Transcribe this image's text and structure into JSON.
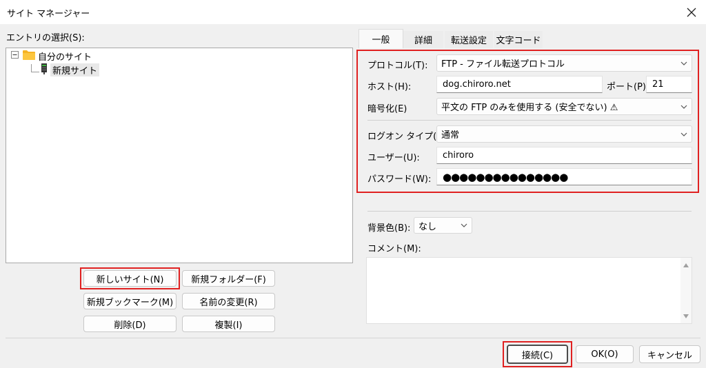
{
  "window": {
    "title": "サイト マネージャー"
  },
  "left": {
    "entries_label": "エントリの選択(S):",
    "tree": {
      "root_label": "自分のサイト",
      "child_label": "新規サイト"
    },
    "buttons": {
      "new_site": "新しいサイト(N)",
      "new_folder": "新規フォルダー(F)",
      "new_bookmark": "新規ブックマーク(M)",
      "rename": "名前の変更(R)",
      "delete": "削除(D)",
      "duplicate": "複製(I)"
    }
  },
  "tabs": [
    "一般",
    "詳細",
    "転送設定",
    "文字コード"
  ],
  "general": {
    "protocol_label": "プロトコル(T):",
    "protocol_value": "FTP - ファイル転送プロトコル",
    "host_label": "ホスト(H):",
    "host_value": "dog.chiroro.net",
    "port_label": "ポート(P):",
    "port_value": "21",
    "encryption_label": "暗号化(E)",
    "encryption_value": "平文の FTP のみを使用する (安全でない) ⚠",
    "logon_type_label": "ログオン タイプ(L):",
    "logon_type_value": "通常",
    "user_label": "ユーザー(U):",
    "user_value": "chiroro",
    "password_label": "パスワード(W):",
    "password_value": "●●●●●●●●●●●●●●●",
    "bgcolor_label": "背景色(B):",
    "bgcolor_value": "なし",
    "comment_label": "コメント(M):"
  },
  "footer": {
    "connect": "接続(C)",
    "ok": "OK(O)",
    "cancel": "キャンセル"
  },
  "colors": {
    "highlight": "#e02020",
    "folder": "#f5b324"
  },
  "icons": [
    "close-icon",
    "collapse-icon",
    "folder-icon",
    "server-icon",
    "chevron-down-icon",
    "scroll-up-icon",
    "scroll-down-icon"
  ]
}
